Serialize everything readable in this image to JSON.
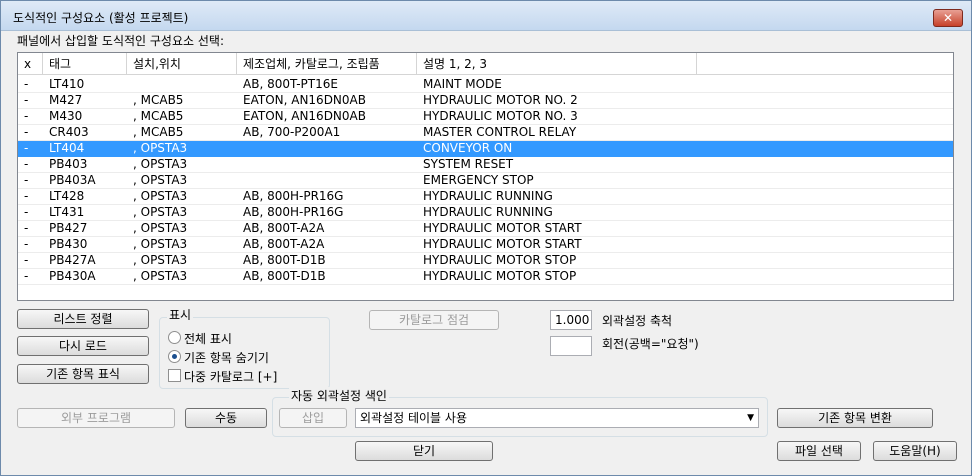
{
  "window": {
    "title": "도식적인 구성요소 (활성 프로젝트)",
    "close_glyph": "✕"
  },
  "list": {
    "prompt": "패널에서 삽입할 도식적인 구성요소 선택:",
    "columns": [
      "x",
      "태그",
      "설치,위치",
      "제조업체, 카탈로그, 조립품",
      "설명 1, 2, 3"
    ],
    "rows": [
      {
        "x": "-",
        "tag": "LT410",
        "loc": "",
        "mfg": "AB, 800T-PT16E",
        "desc": "MAINT MODE"
      },
      {
        "x": "-",
        "tag": "M427",
        "loc": ", MCAB5",
        "mfg": "EATON, AN16DN0AB",
        "desc": "HYDRAULIC MOTOR NO. 2"
      },
      {
        "x": "-",
        "tag": "M430",
        "loc": ", MCAB5",
        "mfg": "EATON, AN16DN0AB",
        "desc": "HYDRAULIC MOTOR NO. 3"
      },
      {
        "x": "-",
        "tag": "CR403",
        "loc": ", MCAB5",
        "mfg": "AB, 700-P200A1",
        "desc": "MASTER CONTROL RELAY"
      },
      {
        "x": "-",
        "tag": "LT404",
        "loc": ", OPSTA3",
        "mfg": "",
        "desc": "CONVEYOR ON"
      },
      {
        "x": "-",
        "tag": "PB403",
        "loc": ", OPSTA3",
        "mfg": "",
        "desc": "SYSTEM RESET"
      },
      {
        "x": "-",
        "tag": "PB403A",
        "loc": ", OPSTA3",
        "mfg": "",
        "desc": "EMERGENCY STOP"
      },
      {
        "x": "-",
        "tag": "LT428",
        "loc": ", OPSTA3",
        "mfg": "AB, 800H-PR16G",
        "desc": "HYDRAULIC RUNNING"
      },
      {
        "x": "-",
        "tag": "LT431",
        "loc": ", OPSTA3",
        "mfg": "AB, 800H-PR16G",
        "desc": "HYDRAULIC RUNNING"
      },
      {
        "x": "-",
        "tag": "PB427",
        "loc": ", OPSTA3",
        "mfg": "AB, 800T-A2A",
        "desc": "HYDRAULIC MOTOR START"
      },
      {
        "x": "-",
        "tag": "PB430",
        "loc": ", OPSTA3",
        "mfg": "AB, 800T-A2A",
        "desc": "HYDRAULIC MOTOR START"
      },
      {
        "x": "-",
        "tag": "PB427A",
        "loc": ", OPSTA3",
        "mfg": "AB, 800T-D1B",
        "desc": "HYDRAULIC MOTOR STOP"
      },
      {
        "x": "-",
        "tag": "PB430A",
        "loc": ", OPSTA3",
        "mfg": "AB, 800T-D1B",
        "desc": "HYDRAULIC MOTOR STOP"
      }
    ],
    "selected_row": 4
  },
  "buttons": {
    "sort_list": "리스트 정렬",
    "reload": "다시 로드",
    "mark_existing": "기존 항목 표식",
    "catalog_check": "카탈로그 점검",
    "external_program": "외부 프로그램",
    "manual": "수동",
    "insert": "삽입",
    "convert_existing": "기존 항목 변환",
    "close": "닫기",
    "select_file": "파일 선택",
    "help": "도움말(H)"
  },
  "display": {
    "group_label": "표시",
    "show_all": "전체 표시",
    "hide_existing": "기존 항목 숨기기",
    "multi_catalog": "다중 카탈로그 [+]",
    "selected": "hide_existing",
    "multi_catalog_checked": false
  },
  "footprint": {
    "scale_label": "외곽설정 축척",
    "scale_value": "1.000",
    "rotation_label": "회전(공백=\"요청\")",
    "rotation_value": ""
  },
  "auto_footprint": {
    "group_label": "자동 외곽설정 색인",
    "combo_value": "외곽설정 테이블 사용"
  },
  "colors": {
    "selection": "#3399ff",
    "title_gradient": "#c4d8ef"
  }
}
